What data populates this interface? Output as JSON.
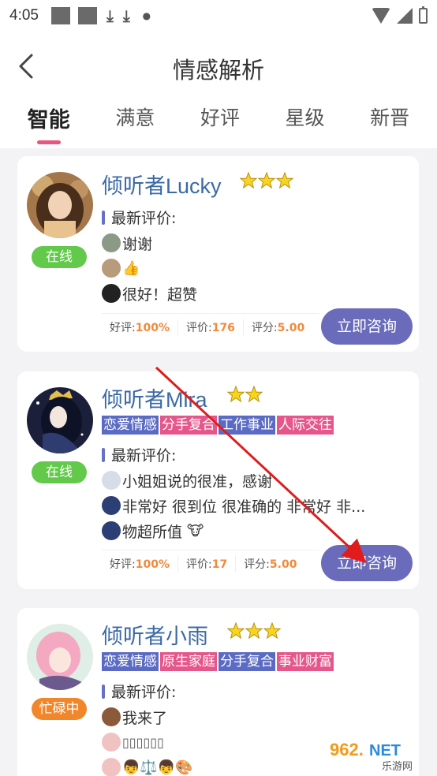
{
  "status_bar": {
    "time": "4:05"
  },
  "header": {
    "title": "情感解析",
    "back_icon": "chevron-left-icon"
  },
  "tabs": [
    {
      "label": "智能",
      "active": true
    },
    {
      "label": "满意"
    },
    {
      "label": "好评"
    },
    {
      "label": "星级"
    },
    {
      "label": "新晋"
    }
  ],
  "cards": [
    {
      "name": "倾听者Lucky",
      "stars": 3,
      "status": "在线",
      "tags": [],
      "review_header": "最新评价:",
      "reviews": [
        "谢谢",
        "",
        "很好！超赞"
      ],
      "stats": {
        "good_label": "好评:",
        "good": "100%",
        "count_label": "评价:",
        "count": "176",
        "score_label": "评分:",
        "score": "5.00"
      },
      "button": "立即咨询"
    },
    {
      "name": "倾听者Mira",
      "stars": 2,
      "status": "在线",
      "tags": [
        "恋爱情感",
        "分手复合",
        "工作事业",
        "人际交往"
      ],
      "review_header": "最新评价:",
      "reviews": [
        "小姐姐说的很准，感谢",
        "非常好 很到位 很准确的 非常好 非...",
        "物超所值"
      ],
      "stats": {
        "good_label": "好评:",
        "good": "100%",
        "count_label": "评价:",
        "count": "17",
        "score_label": "评分:",
        "score": "5.00"
      },
      "button": "立即咨询"
    },
    {
      "name": "倾听者小雨",
      "stars": 3,
      "status": "忙碌中",
      "tags": [
        "恋爱情感",
        "原生家庭",
        "分手复合",
        "事业财富"
      ],
      "review_header": "最新评价:",
      "reviews": [
        "我来了",
        "",
        ""
      ]
    }
  ],
  "colors": {
    "accent": "#6a6cbb",
    "tab_indicator": "#e8557e",
    "name": "#3b69a5",
    "online": "#63c94a",
    "busy": "#f2862a",
    "tag_blue": "#5b6bc3",
    "tag_pink": "#e5578a"
  },
  "watermark": {
    "text": "962.NET",
    "sub": "乐游网"
  }
}
